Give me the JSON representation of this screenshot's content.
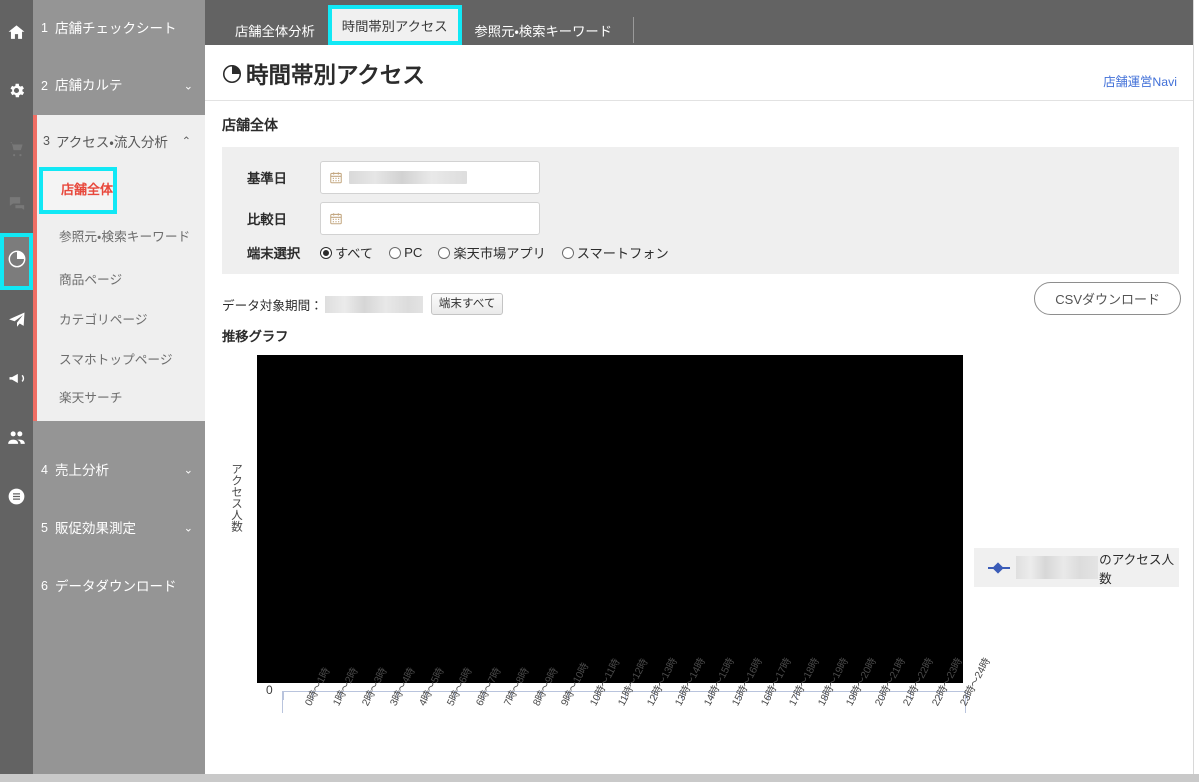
{
  "rail": {
    "icons": [
      {
        "name": "home-icon",
        "dim": false
      },
      {
        "name": "gear-icon",
        "dim": false
      },
      {
        "name": "cart-icon",
        "dim": true
      },
      {
        "name": "chat-icon",
        "dim": true
      },
      {
        "name": "pie-chart-icon",
        "dim": false,
        "active": true
      },
      {
        "name": "paper-plane-icon",
        "dim": false
      },
      {
        "name": "megaphone-icon",
        "dim": false
      },
      {
        "name": "people-icon",
        "dim": false
      },
      {
        "name": "list-icon",
        "dim": false
      }
    ]
  },
  "sidebar": {
    "items": [
      {
        "num": "1",
        "label": "店舗チェックシート",
        "chevron": ""
      },
      {
        "num": "2",
        "label": "店舗カルテ",
        "chevron": "⌄"
      },
      {
        "num": "4",
        "label": "売上分析",
        "chevron": "⌄"
      },
      {
        "num": "5",
        "label": "販促効果測定",
        "chevron": "⌄"
      },
      {
        "num": "6",
        "label": "データダウンロード",
        "chevron": ""
      }
    ],
    "open_group": {
      "num": "3",
      "label": "アクセス・流入分析",
      "chevron": "⌃",
      "sub_items": [
        {
          "label": "店舗全体",
          "selected": true
        },
        {
          "label": "参照元・検索キーワード",
          "selected": false
        },
        {
          "label": "商品ページ",
          "selected": false
        },
        {
          "label": "カテゴリページ",
          "selected": false
        },
        {
          "label": "スマホトップページ",
          "selected": false
        },
        {
          "label": "楽天サーチ",
          "selected": false
        }
      ]
    }
  },
  "tabs": [
    {
      "label": "店舗全体分析",
      "active": false
    },
    {
      "label": "時間帯別アクセス",
      "active": true
    },
    {
      "label": "参照元・検索キーワード",
      "active": false
    }
  ],
  "header": {
    "title": "時間帯別アクセス",
    "title_icon": "clock-pie-icon",
    "navi_link": "店舗運営Navi"
  },
  "filter": {
    "section_label": "店舗全体",
    "base_date": {
      "label": "基準日",
      "value": "",
      "redacted": true,
      "icon": "calendar-icon"
    },
    "compare_date": {
      "label": "比較日",
      "value": "",
      "redacted": false,
      "icon": "calendar-icon"
    },
    "device": {
      "label": "端末選択",
      "options": [
        {
          "label": "すべて",
          "checked": true
        },
        {
          "label": "PC",
          "checked": false
        },
        {
          "label": "楽天市場アプリ",
          "checked": false
        },
        {
          "label": "スマートフォン",
          "checked": false
        }
      ]
    }
  },
  "period": {
    "label": "データ対象期間：",
    "value": "",
    "redacted": true,
    "device_badge": "端末すべて",
    "csv_button": "CSVダウンロード"
  },
  "graph": {
    "label": "推移グラフ",
    "legend_suffix": "のアクセス人数",
    "legend_redacted": true
  },
  "chart_data": {
    "type": "line",
    "title": "推移グラフ",
    "xlabel": "",
    "ylabel": "アクセス人数",
    "categories": [
      "0時～1時",
      "1時～2時",
      "2時～3時",
      "3時～4時",
      "4時～5時",
      "5時～6時",
      "6時～7時",
      "7時～8時",
      "8時～9時",
      "9時～10時",
      "10時～11時",
      "11時～12時",
      "12時～13時",
      "13時～14時",
      "14時～15時",
      "15時～16時",
      "16時～17時",
      "17時～18時",
      "18時～19時",
      "19時～20時",
      "20時～21時",
      "21時～22時",
      "22時～23時",
      "23時～24時"
    ],
    "series": [
      {
        "name": "のアクセス人数",
        "color": "#3b5cb8",
        "values": []
      }
    ],
    "ytick_labels": [
      "0"
    ],
    "grid": false,
    "legend_position": "right",
    "plot_area_masked": true
  },
  "colors": {
    "accent_cyan": "#11e8f5",
    "rail_bg": "#636363",
    "sidebar_bg": "#959595",
    "selected_text": "#e8483c",
    "link_blue": "#4170d8",
    "series_blue": "#3b5cb8"
  }
}
